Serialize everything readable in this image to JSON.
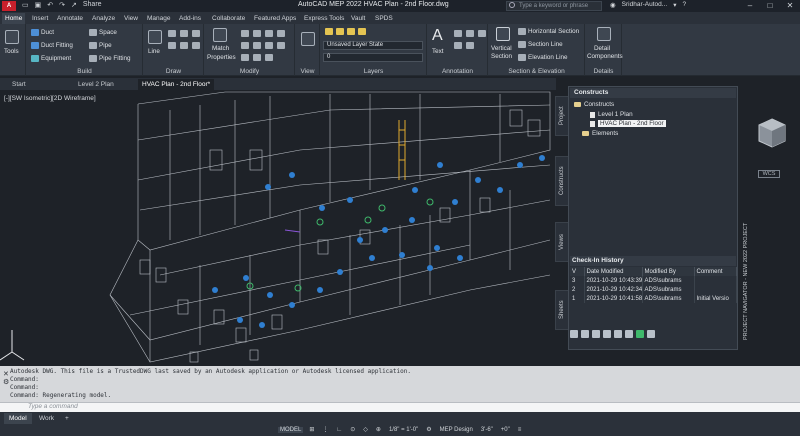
{
  "title_bar": {
    "app_logo": "A",
    "share_label": "Share",
    "window_title": "AutoCAD MEP 2022   HVAC Plan - 2nd Floor.dwg",
    "search_placeholder": "Type a keyword or phrase",
    "user_name": "Sridhar-Autod..."
  },
  "menu_tabs": [
    "Home",
    "Insert",
    "Annotate",
    "Analyze",
    "View",
    "Manage",
    "Add-ins",
    "Collaborate",
    "Featured Apps",
    "Express Tools",
    "Vault",
    "SPDS"
  ],
  "ribbon": {
    "tools": "Tools",
    "build": {
      "title": "Build",
      "duct": "Duct",
      "duct_fitting": "Duct Fitting",
      "equipment": "Equipment",
      "space": "Space",
      "pipe": "Pipe",
      "pipe_fitting": "Pipe Fitting"
    },
    "draw": {
      "title": "Draw",
      "line": "Line"
    },
    "modify": {
      "title": "Modify",
      "match": "Match",
      "properties": "Properties"
    },
    "view": {
      "title": "View"
    },
    "layers": {
      "title": "Layers",
      "layer_state": "Unsaved Layer State",
      "layer_value": "0"
    },
    "annotation": {
      "title": "Annotation",
      "text": "Text"
    },
    "section": {
      "title": "Section & Elevation",
      "vertical_section": "Vertical",
      "vertical_section_2": "Section",
      "horizontal_section": "Horizontal Section",
      "section_line": "Section Line",
      "elevation_line": "Elevation Line"
    },
    "details": {
      "title": "Details",
      "detail": "Detail",
      "components": "Components"
    }
  },
  "doc_tabs": [
    "Start",
    "Level 2 Plan",
    "HVAC Plan - 2nd Floor*"
  ],
  "viewport": {
    "label": "[-][SW Isometric][2D Wireframe]",
    "wcs": "WCS"
  },
  "side_tabs": [
    "Project",
    "Constructs",
    "Views",
    "Sheets"
  ],
  "project_navigator": {
    "panel_title": "Constructs",
    "tree": [
      {
        "label": "Constructs",
        "type": "folder"
      },
      {
        "label": "Level 1 Plan",
        "type": "doc"
      },
      {
        "label": "HVAC Plan - 2nd Floor",
        "type": "doc",
        "selected": true
      },
      {
        "label": "Elements",
        "type": "folder"
      }
    ],
    "vertical_title": "PROJECT NAVIGATOR - NEW 2022 PROJECT"
  },
  "checkin_history": {
    "title": "Check-In History",
    "columns": [
      "V",
      "Date Modified",
      "Modified By",
      "Comment"
    ],
    "rows": [
      [
        "3",
        "2021-10-29 10:43:39",
        "ADS\\subrams",
        ""
      ],
      [
        "2",
        "2021-10-29 10:42:34",
        "ADS\\subrams",
        ""
      ],
      [
        "1",
        "2021-10-29 10:41:58",
        "ADS\\subrams",
        "Initial Versio"
      ]
    ]
  },
  "command_history": [
    "Autodesk DWG.  This file is a TrustedDWG last saved by an Autodesk application or Autodesk licensed application.",
    "Command:",
    "Command:",
    "Command:  Regenerating model."
  ],
  "command_placeholder": "Type a command",
  "status": {
    "layout_tabs": [
      "Model",
      "Work"
    ],
    "add_tab": "+",
    "model_button": "MODEL",
    "scale": "1/8\" = 1'-0\"",
    "design": "MEP Design",
    "value": "3'-6\"",
    "offset": "+0\""
  },
  "colors": {
    "accent": "#4d8fd6",
    "background": "#1e2228",
    "brand_red": "#c8202c"
  }
}
